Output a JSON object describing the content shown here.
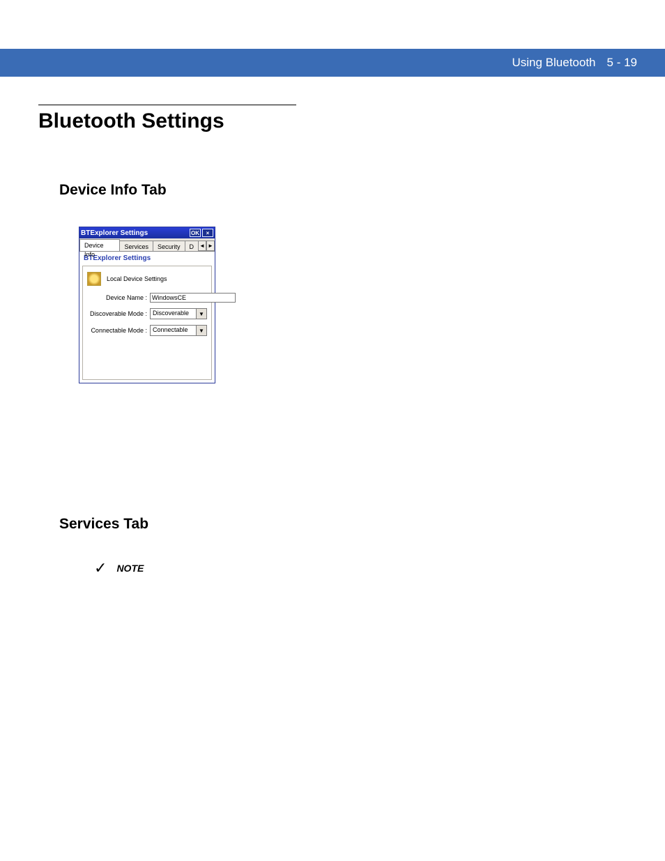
{
  "header": {
    "section": "Using Bluetooth",
    "page": "5 - 19"
  },
  "h1": "Bluetooth Settings",
  "device_info": {
    "heading": "Device Info Tab"
  },
  "wince": {
    "title": "BTExplorer Settings",
    "ok": "OK",
    "close": "×",
    "tabs": {
      "t0": "Device Info",
      "t1": "Services",
      "t2": "Security",
      "t3": "D",
      "left": "◄",
      "right": "►"
    },
    "subtitle": "BTExplorer Settings",
    "lds": "Local Device Settings",
    "fields": {
      "devname_label": "Device Name :",
      "devname_value": "WindowsCE",
      "disc_label": "Discoverable Mode :",
      "disc_value": "Discoverable",
      "conn_label": "Connectable Mode :",
      "conn_value": "Connectable"
    }
  },
  "services": {
    "heading": "Services Tab",
    "note_label": "NOTE"
  }
}
